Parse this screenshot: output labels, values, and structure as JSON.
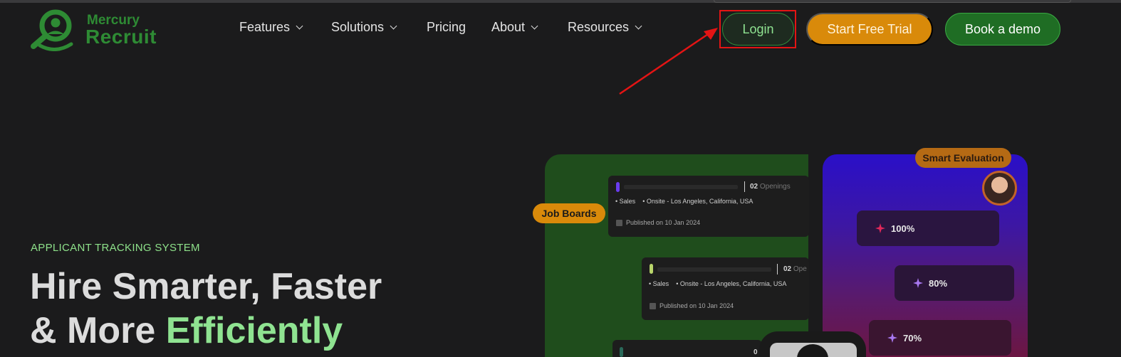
{
  "brand": {
    "name_top": "Mercury",
    "name_bottom": "Recruit",
    "color": "#2e8b34"
  },
  "nav": {
    "items": [
      {
        "label": "Features",
        "dropdown": true
      },
      {
        "label": "Solutions",
        "dropdown": true
      },
      {
        "label": "Pricing",
        "dropdown": false
      },
      {
        "label": "About",
        "dropdown": true
      },
      {
        "label": "Resources",
        "dropdown": true
      }
    ]
  },
  "actions": {
    "login": "Login",
    "trial": "Start Free Trial",
    "demo": "Book a demo"
  },
  "hero": {
    "eyebrow": "APPLICANT TRACKING SYSTEM",
    "line1": "Hire Smarter, Faster",
    "line2_prefix": "& More ",
    "line2_accent": "Efficiently"
  },
  "job_boards": {
    "tag": "Job Boards",
    "cards": [
      {
        "openings_count": "02",
        "openings_label": "Openings",
        "department": "• Sales",
        "location": "• Onsite - Los Angeles, California, USA",
        "published": "Published on 10 Jan 2024",
        "bar_color": "#6a3cf0"
      },
      {
        "openings_count": "02",
        "openings_label": "Ope",
        "department": "• Sales",
        "location": "• Onsite - Los Angeles, California, USA",
        "published": "Published on 10 Jan 2024",
        "bar_color": "#b8d46a"
      },
      {
        "openings_count": "0",
        "openings_label": "",
        "bar_color": "#2a6a5a"
      }
    ]
  },
  "evaluation": {
    "tag": "Smart Evaluation",
    "scores": [
      {
        "value": "100%",
        "icon_color": "#e0285a"
      },
      {
        "value": "80%",
        "icon_color": "#a878f0"
      },
      {
        "value": "70%",
        "icon_color": "#a878f0"
      }
    ]
  },
  "colors": {
    "background": "#1b1b1c",
    "accent_green": "#8fe391",
    "orange": "#d98a0a",
    "highlight_red": "#e41414"
  }
}
